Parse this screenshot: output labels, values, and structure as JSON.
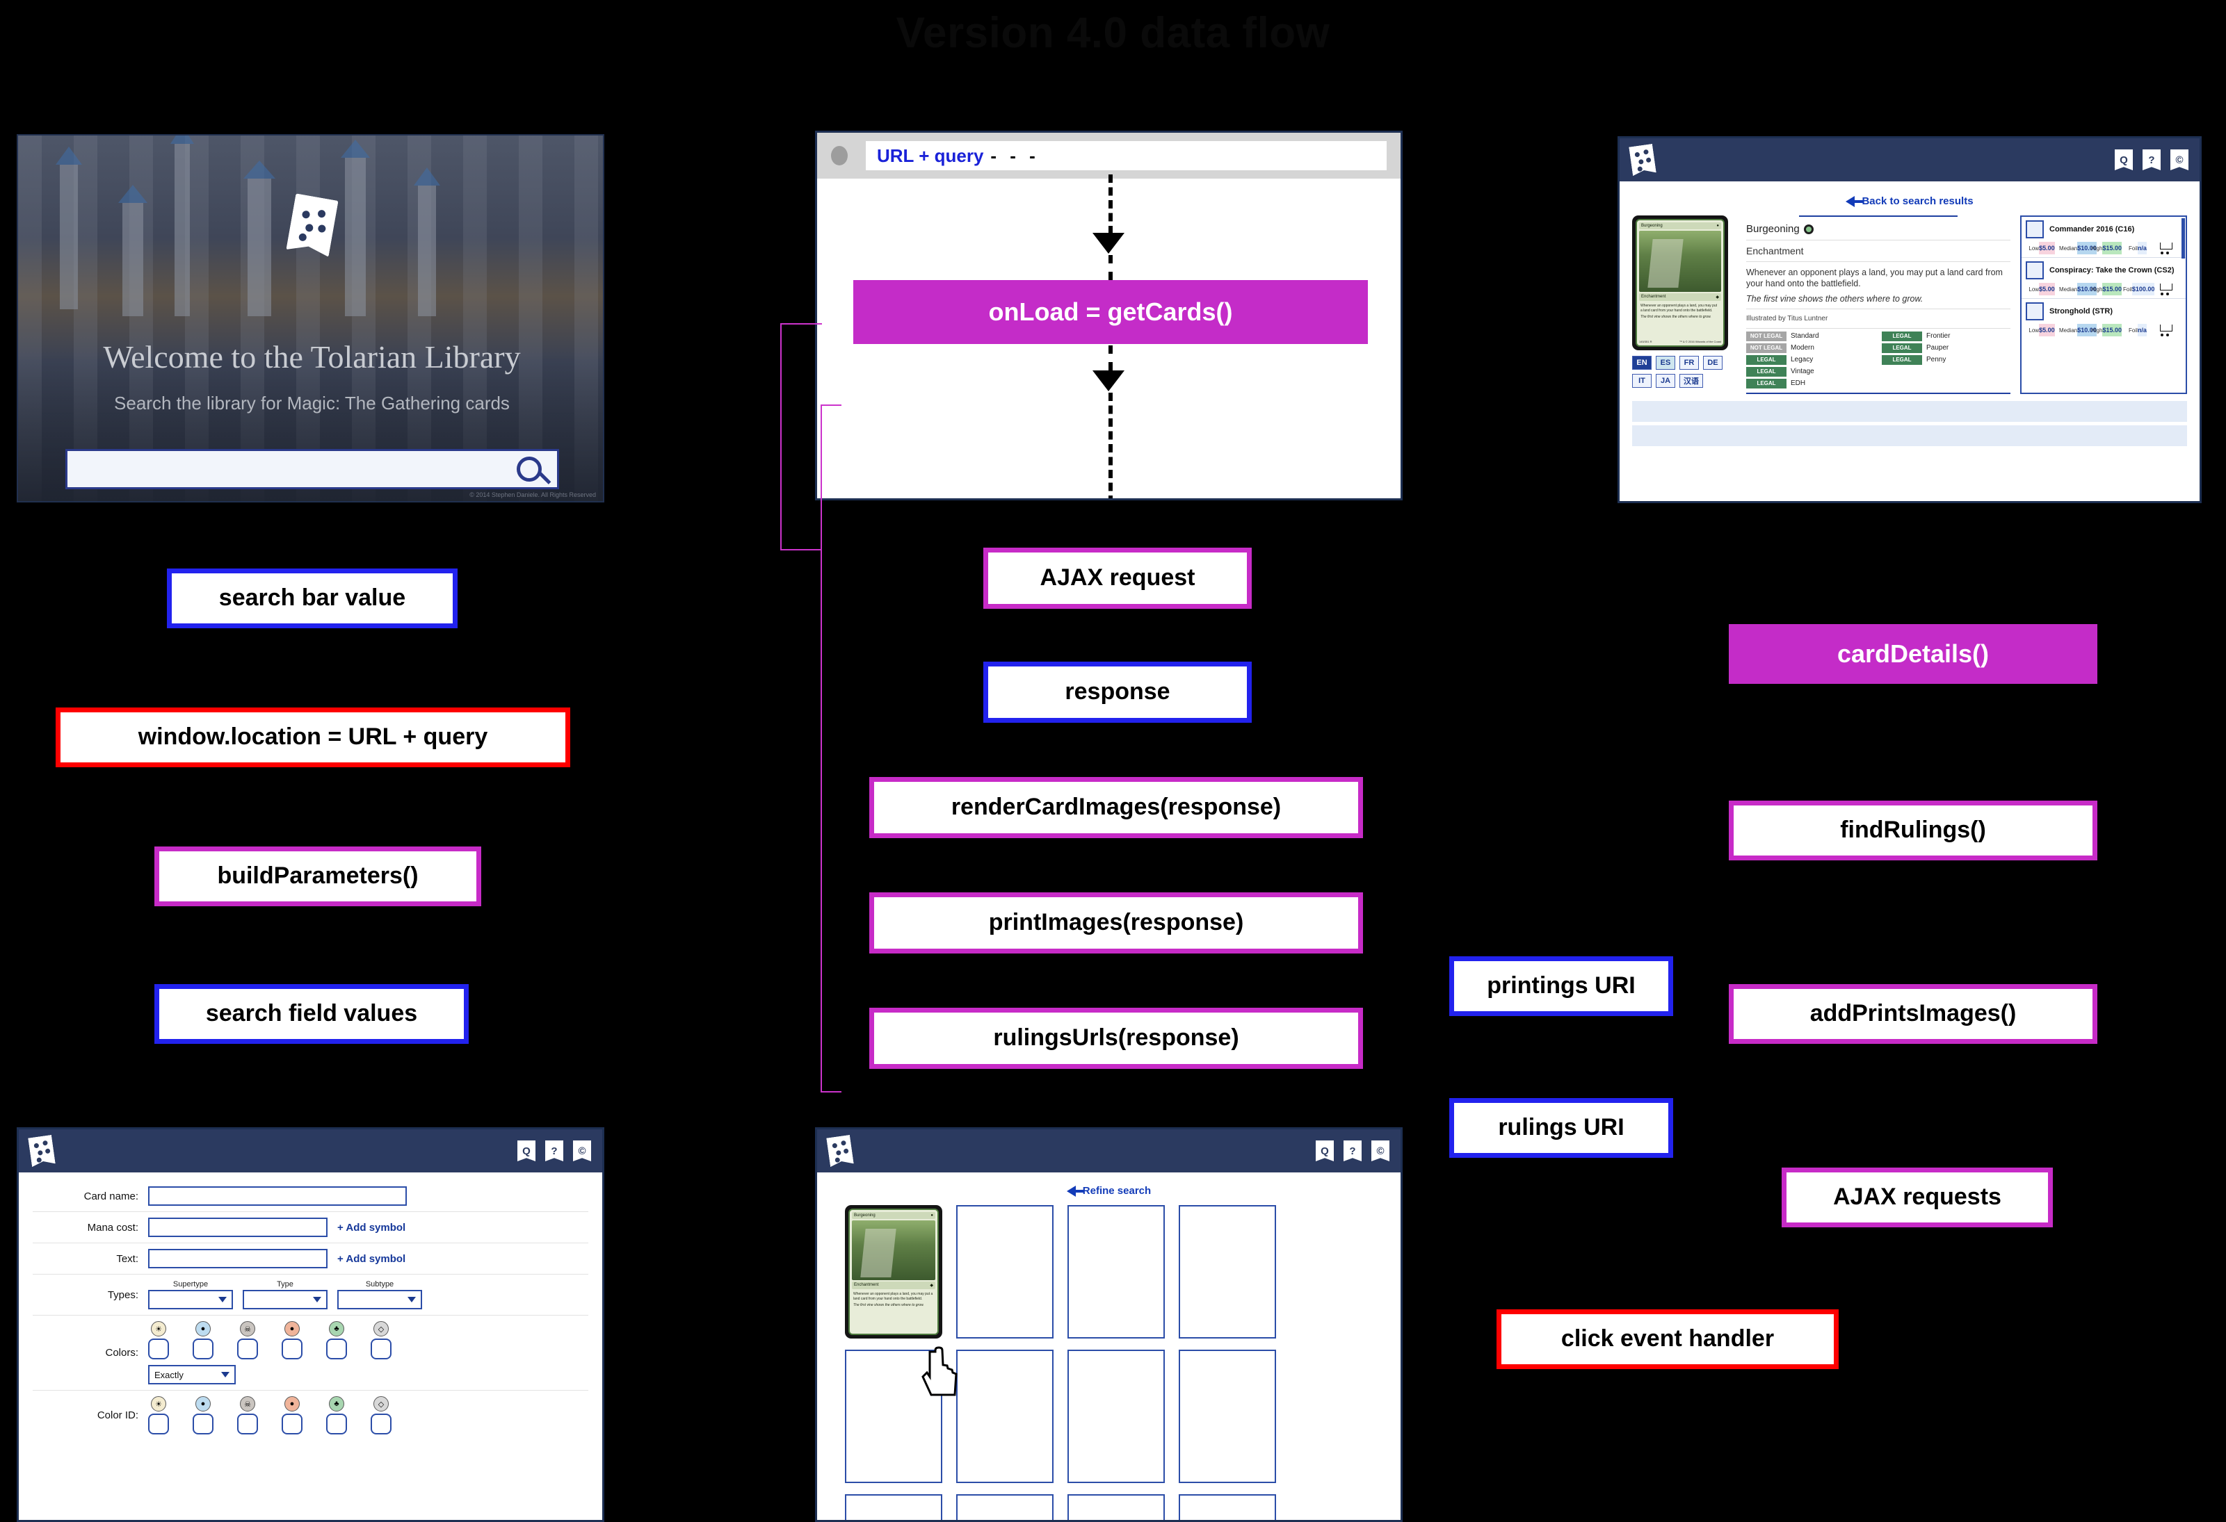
{
  "diagram": {
    "title": "Version 4.0 data flow",
    "colors": {
      "blue_border": "#2222ee",
      "red_border": "#fe0000",
      "magenta_border": "#c72bc7",
      "magenta_fill": "#c42cc8",
      "connector": "#cc33cc",
      "background": "#000000"
    },
    "nodes": [
      {
        "id": "search-bar-value",
        "label": "search bar value",
        "style": "blue"
      },
      {
        "id": "window-location",
        "label": "window.location = URL + query",
        "style": "red"
      },
      {
        "id": "build-parameters",
        "label": "buildParameters()",
        "style": "magenta"
      },
      {
        "id": "search-field-values",
        "label": "search field values",
        "style": "blue"
      },
      {
        "id": "ajax-request",
        "label": "AJAX request",
        "style": "magenta"
      },
      {
        "id": "response",
        "label": "response",
        "style": "blue"
      },
      {
        "id": "render-card-images",
        "label": "renderCardImages(response)",
        "style": "magenta"
      },
      {
        "id": "print-images",
        "label": "printImages(response)",
        "style": "magenta"
      },
      {
        "id": "rulings-urls",
        "label": "rulingsUrls(response)",
        "style": "magenta"
      },
      {
        "id": "card-details",
        "label": "cardDetails()",
        "style": "fill"
      },
      {
        "id": "find-rulings",
        "label": "findRulings()",
        "style": "magenta"
      },
      {
        "id": "printings-uri",
        "label": "printings URI",
        "style": "blue"
      },
      {
        "id": "add-prints-images",
        "label": "addPrintsImages()",
        "style": "magenta"
      },
      {
        "id": "rulings-uri",
        "label": "rulings URI",
        "style": "blue"
      },
      {
        "id": "ajax-requests",
        "label": "AJAX requests",
        "style": "magenta"
      },
      {
        "id": "click-event-handler",
        "label": "click event handler",
        "style": "red"
      },
      {
        "id": "on-load-get-cards",
        "label": "onLoad = getCards()",
        "style": "fill"
      }
    ]
  },
  "landing": {
    "heading": "Welcome to the Tolarian Library",
    "subheading": "Search the library for Magic: The Gathering cards",
    "search_placeholder": "",
    "search_value": "",
    "search_icon": "search-icon",
    "quick_links": [
      {
        "icon": "search-icon",
        "glyph": "Q"
      },
      {
        "icon": "help-icon",
        "glyph": "?"
      },
      {
        "icon": "copyright-icon",
        "glyph": "©"
      }
    ],
    "footer": "© 2014 Stephen Daniele. All Rights Reserved"
  },
  "url_window": {
    "address_value": "URL + query",
    "dots": "- - -",
    "callout": "onLoad = getCards()"
  },
  "chrome": {
    "logo": "tolarian-library-logo",
    "icons": [
      {
        "name": "search-icon",
        "glyph": "Q"
      },
      {
        "name": "help-icon",
        "glyph": "?"
      },
      {
        "name": "copyright-icon",
        "glyph": "©"
      }
    ]
  },
  "card_detail": {
    "back_link": "Back to search results",
    "card": {
      "name": "Burgeoning",
      "type_line": "Enchantment",
      "rules_text": "Whenever an opponent plays a land, you may put a land card from your hand onto the battlefield.",
      "flavor_text": "The first vine shows the others where to grow.",
      "illustrator": "Illustrated by Titus Luntner",
      "collector": "145/351 R",
      "set_code": "C16 · EN · TITUS LUNTNER",
      "copyright": "™ & © 2016 Wizards of the Coast"
    },
    "languages": [
      {
        "code": "EN",
        "selected": true
      },
      {
        "code": "ES",
        "selected": false,
        "alt": true
      },
      {
        "code": "FR",
        "selected": false
      },
      {
        "code": "DE",
        "selected": false
      },
      {
        "code": "IT",
        "selected": false
      },
      {
        "code": "JA",
        "selected": false
      },
      {
        "code": "汉语",
        "selected": false
      }
    ],
    "legalities": [
      {
        "format": "Standard",
        "status": "NOT LEGAL"
      },
      {
        "format": "Frontier",
        "status": "LEGAL"
      },
      {
        "format": "Modern",
        "status": "NOT LEGAL"
      },
      {
        "format": "Pauper",
        "status": "LEGAL"
      },
      {
        "format": "Legacy",
        "status": "LEGAL"
      },
      {
        "format": "Penny",
        "status": "LEGAL"
      },
      {
        "format": "Vintage",
        "status": "LEGAL"
      },
      {
        "format": "EDH",
        "status": "LEGAL"
      }
    ],
    "price_headers": [
      "Low",
      "Median",
      "High",
      "Foil"
    ],
    "printings": [
      {
        "set": "Commander 2016 (C16)",
        "low": "$5.00",
        "median": "$10.00",
        "high": "$15.00",
        "foil": "n/a"
      },
      {
        "set": "Conspiracy: Take the Crown (CS2)",
        "low": "$5.00",
        "median": "$10.00",
        "high": "$15.00",
        "foil": "$100.00"
      },
      {
        "set": "Stronghold (STR)",
        "low": "$5.00",
        "median": "$10.00",
        "high": "$15.00",
        "foil": "n/a"
      }
    ],
    "cart_icon": "shopping-cart-icon"
  },
  "search_form": {
    "fields": [
      {
        "label": "Card name:",
        "value": "",
        "placeholder": ""
      },
      {
        "label": "Mana cost:",
        "value": "",
        "placeholder": "",
        "add_symbol": "+ Add symbol"
      },
      {
        "label": "Text:",
        "value": "",
        "placeholder": "",
        "add_symbol": "+ Add symbol"
      }
    ],
    "types_label": "Types:",
    "type_selects": [
      {
        "caption": "Supertype",
        "value": ""
      },
      {
        "caption": "Type",
        "value": ""
      },
      {
        "caption": "Subtype",
        "value": ""
      }
    ],
    "colors_label": "Colors:",
    "color_id_label": "Color ID:",
    "mana_symbols": [
      {
        "name": "white-mana-icon",
        "glyph": "☀",
        "color": "#f4ecd0"
      },
      {
        "name": "blue-mana-icon",
        "glyph": "●",
        "color": "#bddcf0"
      },
      {
        "name": "black-mana-icon",
        "glyph": "☠",
        "color": "#cac5c0"
      },
      {
        "name": "red-mana-icon",
        "glyph": "●",
        "color": "#f0b49a"
      },
      {
        "name": "green-mana-icon",
        "glyph": "♣",
        "color": "#a8d6b0"
      },
      {
        "name": "colorless-mana-icon",
        "glyph": "◇",
        "color": "#d8d8d8"
      }
    ],
    "color_match_value": "Exactly"
  },
  "results": {
    "refine_link": "Refine search",
    "cursor": "pointer-hand-cursor",
    "first_card_name": "Burgeoning",
    "first_card_type": "Enchantment",
    "first_card_text": "Whenever an opponent plays a land, you may put a land card from your hand onto the battlefield.",
    "first_card_flavor": "The first vine shows the others where to grow.",
    "empty_slots": 11
  }
}
